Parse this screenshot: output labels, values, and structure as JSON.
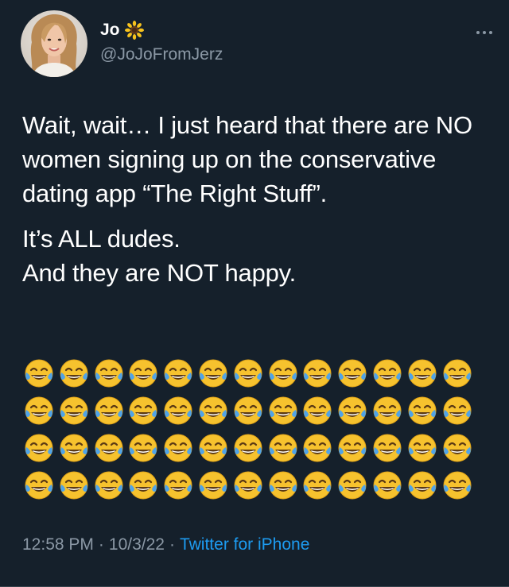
{
  "author": {
    "display_name": "Jo",
    "handle": "@JoJoFromJerz",
    "name_emoji_icon": "sunflower-icon"
  },
  "tweet": {
    "paragraph1": "Wait, wait… I just heard that there are NO women signing up on the conservative dating app “The Right Stuff”.",
    "paragraph2_line1": "It’s ALL dudes.",
    "paragraph2_line2": "And they are NOT happy.",
    "emoji_icon": "face-with-tears-of-joy-icon",
    "emoji_rows": 4,
    "emoji_per_row": 13
  },
  "meta": {
    "time": "12:58 PM",
    "date": "10/3/22",
    "separator": "·",
    "source": "Twitter for iPhone"
  },
  "colors": {
    "background": "#15202b",
    "text_primary": "#ffffff",
    "text_secondary": "#8b98a5",
    "link": "#1d9bf0"
  }
}
